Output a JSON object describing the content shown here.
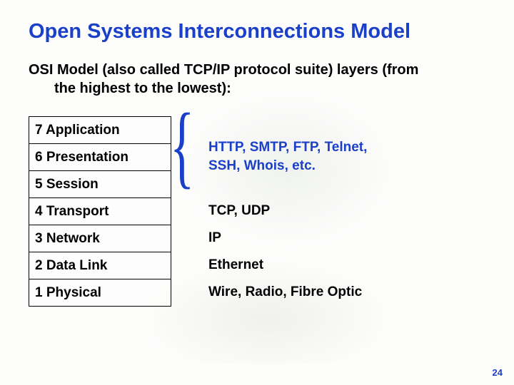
{
  "title": "Open Systems Interconnections Model",
  "subtitle_line1": "OSI Model (also called TCP/IP protocol suite) layers (from",
  "subtitle_line2": "the highest to the lowest):",
  "layers": {
    "r7": "7 Application",
    "r6": "6 Presentation",
    "r5": "5 Session",
    "r4": "4 Transport",
    "r3": "3 Network",
    "r2": "2 Data Link",
    "r1": "1 Physical"
  },
  "brace": "{",
  "examples": {
    "upper_line1": "HTTP, SMTP, FTP, Telnet,",
    "upper_line2": "SSH, Whois, etc.",
    "transport": "TCP, UDP",
    "network": "IP",
    "datalink": "Ethernet",
    "physical": "Wire, Radio, Fibre Optic"
  },
  "page_number": "24"
}
